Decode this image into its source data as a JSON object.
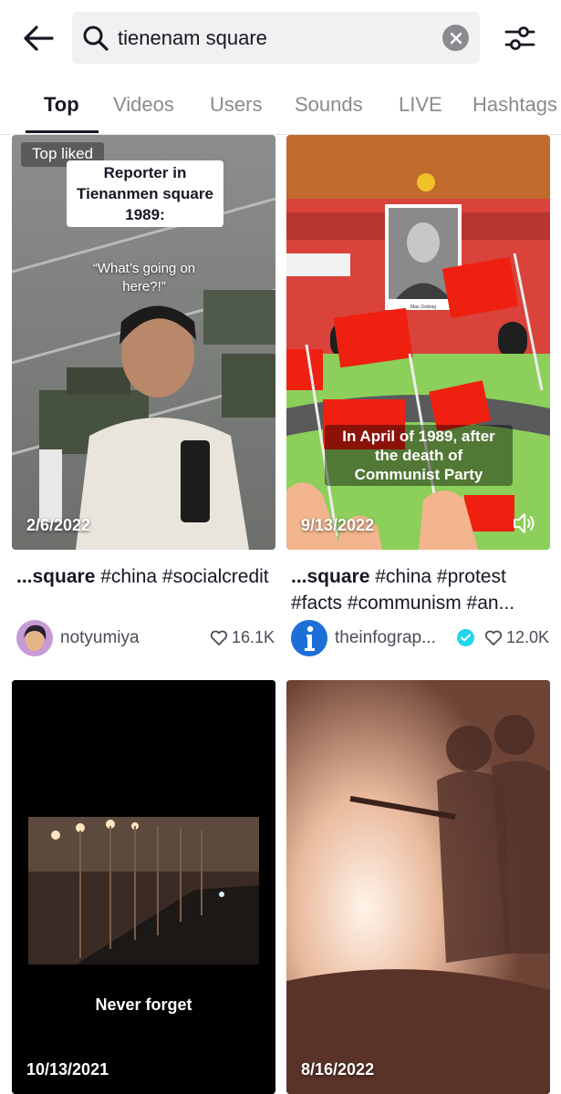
{
  "search": {
    "query": "tienenam square",
    "back_icon": "arrow-left-icon",
    "search_icon": "search-icon",
    "clear_icon": "clear-icon",
    "filter_icon": "filter-sliders-icon"
  },
  "tabs": [
    {
      "label": "Top",
      "active": true
    },
    {
      "label": "Videos",
      "active": false
    },
    {
      "label": "Users",
      "active": false
    },
    {
      "label": "Sounds",
      "active": false
    },
    {
      "label": "LIVE",
      "active": false
    },
    {
      "label": "Hashtags",
      "active": false
    }
  ],
  "results": [
    {
      "badge": "Top liked",
      "overlay_title": "Reporter in Tienanmen square 1989:",
      "overlay_quote": "“What’s going on here?!”",
      "date": "2/6/2022",
      "caption_bold": "...square",
      "caption_rest": " #china #socialcredit",
      "username": "notyumiya",
      "likes": "16.1K"
    },
    {
      "overlay_text": "In April of 1989, after the death of Communist Party",
      "portrait_caption": "Mao Zedong",
      "date": "9/13/2022",
      "caption_bold": "...square",
      "caption_rest": " #china #protest #facts #communism #an...",
      "username": "theinfograp...",
      "verified": true,
      "likes": "12.0K",
      "sound_icon": "volume-icon"
    },
    {
      "overlay_text": "Never forget",
      "date": "10/13/2021"
    },
    {
      "date": "8/16/2022"
    }
  ],
  "colors": {
    "text_primary": "#161823",
    "text_secondary": "#8a8b91",
    "verified": "#20d5ec",
    "search_bg": "#f1f1f2"
  }
}
